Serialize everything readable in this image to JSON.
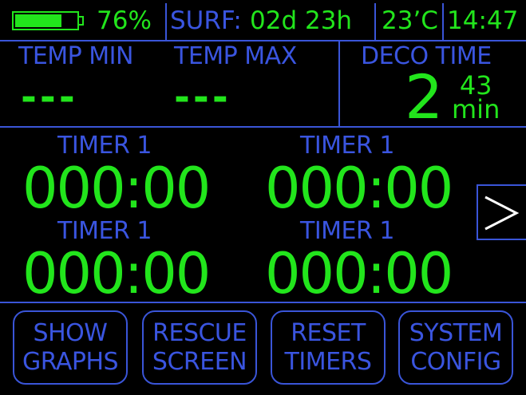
{
  "status_bar": {
    "battery_level": 0.76,
    "battery_percent": "76%",
    "surface_label": "SURF:",
    "surface_time": "02d 23h",
    "temperature": "23’C",
    "clock": "14:47"
  },
  "header": {
    "temp_min_label": "TEMP MIN",
    "temp_min_value": "---",
    "temp_max_label": "TEMP MAX",
    "temp_max_value": "---",
    "deco_label": "DECO TIME",
    "deco_value_main": "2",
    "deco_value_sub": "43",
    "deco_unit": "min"
  },
  "timers": [
    {
      "label": "TIMER 1",
      "value": "000:00"
    },
    {
      "label": "TIMER 1",
      "value": "000:00"
    },
    {
      "label": "TIMER 1",
      "value": "000:00"
    },
    {
      "label": "TIMER 1",
      "value": "000:00"
    }
  ],
  "next_button": {
    "icon": "chevron-right-icon"
  },
  "buttons": [
    {
      "line1": "SHOW",
      "line2": "GRAPHS"
    },
    {
      "line1": "RESCUE",
      "line2": "SCREEN"
    },
    {
      "line1": "RESET",
      "line2": "TIMERS"
    },
    {
      "line1": "SYSTEM",
      "line2": "CONFIG"
    }
  ],
  "colors": {
    "accent_green": "#22e51c",
    "accent_blue": "#3a55e0",
    "background": "#000000"
  }
}
